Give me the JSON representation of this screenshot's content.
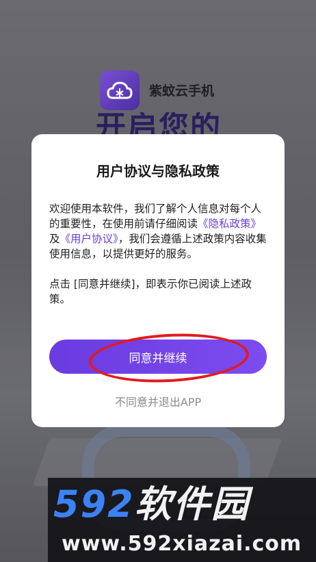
{
  "splash": {
    "app_name": "紫蚊云手机",
    "hero_text": "开启您的"
  },
  "dialog": {
    "title": "用户协议与隐私政策",
    "body_part1": "欢迎使用本软件，我们了解个人信息对每个人的重要性，在使用前请仔细阅读",
    "privacy_link": "《隐私政策》",
    "conjunction": "及",
    "terms_link": "《用户协议》",
    "body_part2": "，我们会遵循上述政策内容收集使用信息，以提供更好的服务。",
    "body_para2": "点击 [同意并继续]，即表示你已阅读上述政策。",
    "agree_label": "同意并继续",
    "decline_label": "不同意并退出APP"
  },
  "watermark": {
    "brand_num": "592",
    "brand_cn": "软件园",
    "url": "www.592xiazai.com"
  },
  "colors": {
    "accent": "#7043e6",
    "link": "#6a3fd1",
    "annotation": "#e21b1b"
  },
  "icons": {
    "app_logo": "cloud-phone-icon"
  }
}
